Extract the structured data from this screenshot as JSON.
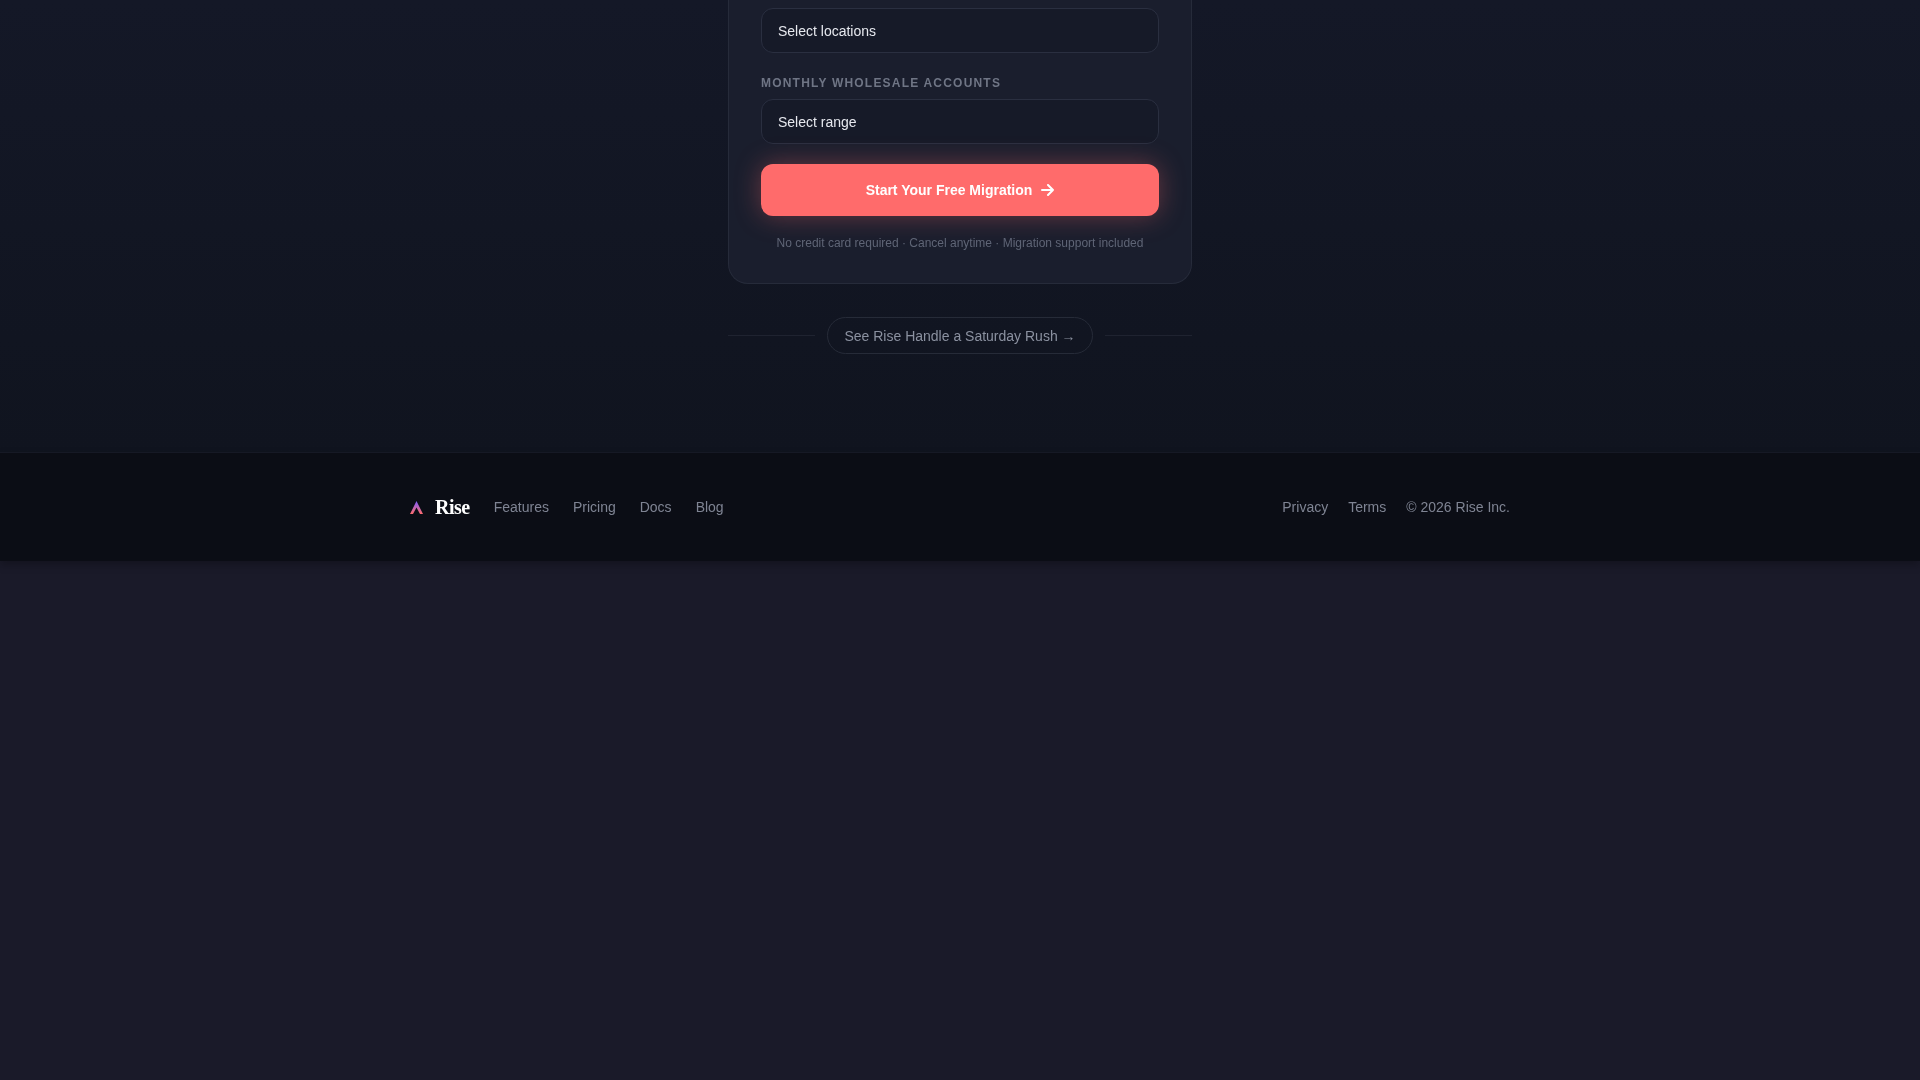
{
  "form_card": {
    "fields": [
      {
        "value": "Select locations"
      },
      {
        "label": "MONTHLY WHOLESALE ACCOUNTS",
        "value": "Select range"
      }
    ],
    "submit_button": {
      "label": "Start Your Free Migration"
    },
    "fine_print": "No credit card required · Cancel anytime · Migration support included"
  },
  "demo_link": {
    "label": "See Rise Handle a Saturday Rush →"
  },
  "footer": {
    "brand": "Rise",
    "nav_links": [
      "Features",
      "Pricing",
      "Docs",
      "Blog"
    ],
    "legal_links": [
      "Privacy",
      "Terms"
    ],
    "copyright": "© 2026 Rise Inc."
  }
}
